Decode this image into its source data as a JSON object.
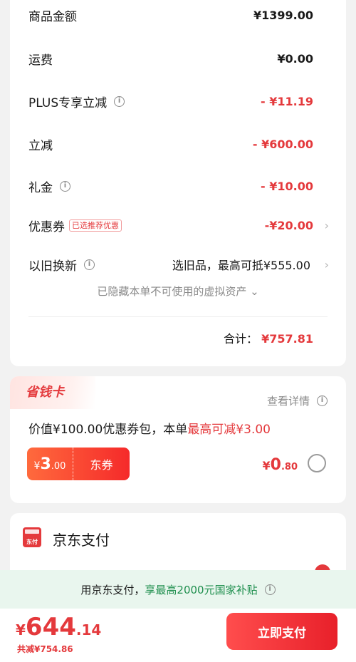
{
  "summary": {
    "rows": [
      {
        "label": "商品金额",
        "value": "¥1399.00"
      },
      {
        "label": "运费",
        "value": "¥0.00"
      },
      {
        "label": "PLUS专享立减",
        "value": "- ¥11.19"
      },
      {
        "label": "立减",
        "value": "- ¥600.00"
      },
      {
        "label": "礼金",
        "value": "- ¥10.00"
      },
      {
        "label": "优惠券",
        "tag": "已选推荐优惠",
        "value": "-¥20.00"
      },
      {
        "label": "以旧换新",
        "value": "选旧品，最高可抵¥555.00"
      }
    ],
    "hidden_assets": "已隐藏本单不可使用的虚拟资产",
    "hidden_chevron": "⌄",
    "total_label": "合计：",
    "total_value": "¥757.81",
    "info_glyph": "i",
    "chevron_glyph": "›"
  },
  "save_card": {
    "title": "省钱卡",
    "detail_label": "查看详情",
    "desc_prefix": "价值¥100.00优惠券包，本单",
    "desc_highlight": "最高可减¥3.00",
    "coupon": {
      "yen": "¥",
      "int": "3",
      "dec": ".00",
      "name": "东券"
    },
    "price": {
      "yen": "¥",
      "int": "0",
      "dec": ".80"
    }
  },
  "payment": {
    "icon_text": "东付",
    "title": "京东支付"
  },
  "subsidy": {
    "prefix": "用京东支付，",
    "highlight": "享最高2000元国家补贴"
  },
  "bottom": {
    "price": {
      "yen": "¥",
      "int": "644",
      "dec": ".14"
    },
    "saved": "共减¥754.86",
    "pay_button": "立即支付"
  },
  "colors": {
    "accent": "#e4393c",
    "subsidy_green": "#1f8f4e"
  },
  "icons": {
    "info": "info-circle-icon",
    "chevron": "chevron-right-icon",
    "radio": "radio-unchecked-icon"
  }
}
